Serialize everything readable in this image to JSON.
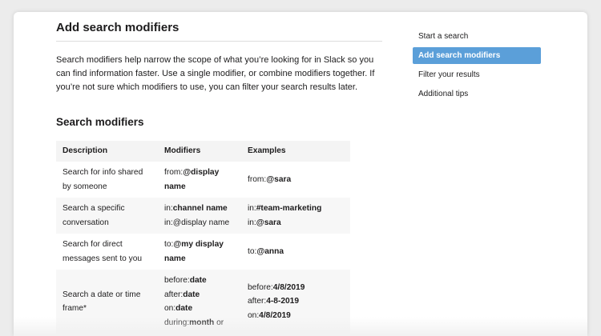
{
  "article": {
    "title": "Add search modifiers",
    "intro": "Search modifiers help narrow the scope of what you’re looking for in Slack so you can find information faster. Use a single modifier, or combine modifiers together. If you’re not sure which modifiers to use, you can filter your search results later.",
    "section_title": "Search modifiers"
  },
  "table": {
    "headers": [
      "Description",
      "Modifiers",
      "Examples"
    ],
    "rows": [
      {
        "description": "Search for info shared by someone",
        "modifiers": [
          [
            {
              "t": "from:",
              "b": false
            },
            {
              "t": "@display name",
              "b": true
            }
          ]
        ],
        "examples": [
          [
            {
              "t": "from:",
              "b": false
            },
            {
              "t": "@sara",
              "b": true
            }
          ]
        ]
      },
      {
        "description": "Search a specific conversation",
        "modifiers": [
          [
            {
              "t": "in:",
              "b": false
            },
            {
              "t": "channel name",
              "b": true
            }
          ],
          [
            {
              "t": "in:",
              "b": false
            },
            {
              "t": "@display name",
              "b": false
            }
          ]
        ],
        "examples": [
          [
            {
              "t": "in:",
              "b": false
            },
            {
              "t": "#team-marketing",
              "b": true
            }
          ],
          [
            {
              "t": "in:",
              "b": false
            },
            {
              "t": "@sara",
              "b": true
            }
          ]
        ]
      },
      {
        "description": "Search for direct messages sent to you",
        "modifiers": [
          [
            {
              "t": "to:",
              "b": false
            },
            {
              "t": "@my display name",
              "b": true
            }
          ]
        ],
        "examples": [
          [
            {
              "t": "to:",
              "b": false
            },
            {
              "t": "@anna",
              "b": true
            }
          ]
        ]
      },
      {
        "description": "Search a date or time frame*",
        "modifiers": [
          [
            {
              "t": "before:",
              "b": false
            },
            {
              "t": "date",
              "b": true
            }
          ],
          [
            {
              "t": "after:",
              "b": false
            },
            {
              "t": "date",
              "b": true
            }
          ],
          [
            {
              "t": "on:",
              "b": false
            },
            {
              "t": "date",
              "b": true
            }
          ],
          [
            {
              "t": "during:",
              "b": false
            },
            {
              "t": "month",
              "b": true
            },
            {
              "t": " or",
              "b": false
            }
          ]
        ],
        "examples": [
          [
            {
              "t": "before:",
              "b": false
            },
            {
              "t": "4/8/2019",
              "b": true
            }
          ],
          [
            {
              "t": "after:",
              "b": false
            },
            {
              "t": "4-8-2019",
              "b": true
            }
          ],
          [
            {
              "t": "on:",
              "b": false
            },
            {
              "t": "4/8/2019",
              "b": true
            }
          ]
        ]
      }
    ]
  },
  "sidebar": {
    "items": [
      {
        "label": "Start a search",
        "active": false
      },
      {
        "label": "Add search modifiers",
        "active": true
      },
      {
        "label": "Filter your results",
        "active": false
      },
      {
        "label": "Additional tips",
        "active": false
      }
    ]
  },
  "colors": {
    "accent": "#5b9fd9",
    "table_header_bg": "#f4f4f4",
    "row_shade_bg": "#f7f7f7"
  }
}
